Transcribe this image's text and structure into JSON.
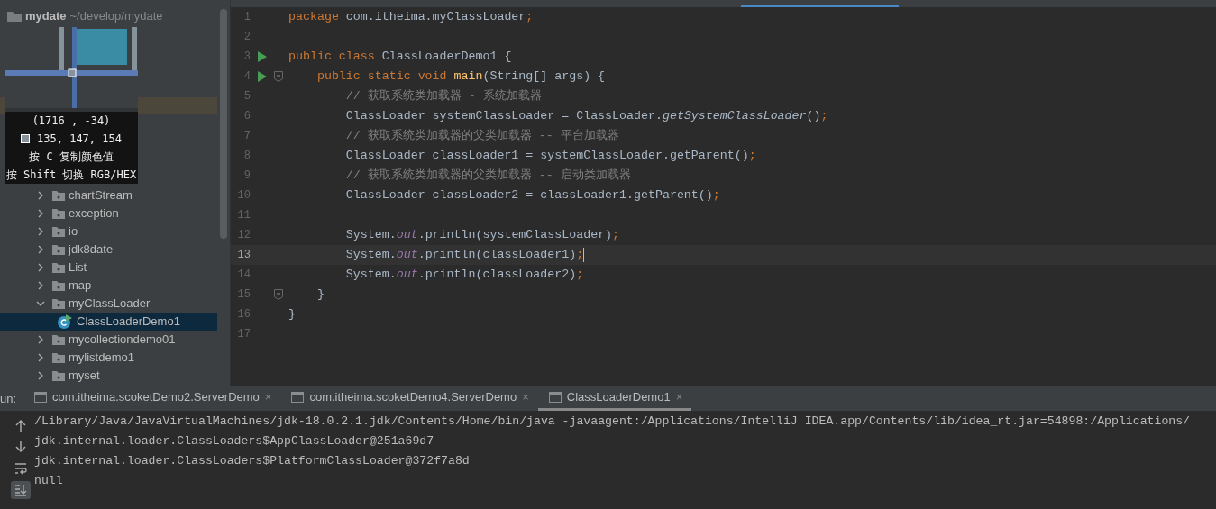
{
  "sidebar": {
    "root": {
      "name": "mydate",
      "path": "~/develop/mydate"
    },
    "items": [
      {
        "label": "chartStream",
        "kind": "folder",
        "expanded": false,
        "selected": false
      },
      {
        "label": "exception",
        "kind": "folder",
        "expanded": false,
        "selected": false
      },
      {
        "label": "io",
        "kind": "folder",
        "expanded": false,
        "selected": false
      },
      {
        "label": "jdk8date",
        "kind": "folder",
        "expanded": false,
        "selected": false
      },
      {
        "label": "List",
        "kind": "folder",
        "expanded": false,
        "selected": false
      },
      {
        "label": "map",
        "kind": "folder",
        "expanded": false,
        "selected": false
      },
      {
        "label": "myClassLoader",
        "kind": "folder",
        "expanded": true,
        "selected": false,
        "children": [
          {
            "label": "ClassLoaderDemo1",
            "kind": "class",
            "selected": true
          }
        ]
      },
      {
        "label": "mycollectiondemo01",
        "kind": "folder",
        "expanded": false,
        "selected": false
      },
      {
        "label": "mylistdemo1",
        "kind": "folder",
        "expanded": false,
        "selected": false
      },
      {
        "label": "myset",
        "kind": "folder",
        "expanded": false,
        "selected": false
      }
    ]
  },
  "color_picker": {
    "coordinates": "(1716 , -34)",
    "rgb": "135, 147, 154",
    "hints": [
      "按 C 复制颜色值",
      "按 Shift 切换 RGB/HEX"
    ]
  },
  "editor": {
    "lines": [
      {
        "number": "1",
        "runnable": false,
        "fold": false,
        "current": false,
        "segments": [
          {
            "kind": "keyword",
            "text": "package "
          },
          {
            "kind": "plain",
            "text": "com.itheima.myClassLoader"
          },
          {
            "kind": "keyword",
            "text": ";"
          }
        ]
      },
      {
        "number": "2",
        "runnable": false,
        "fold": false,
        "current": false
      },
      {
        "number": "3",
        "runnable": true,
        "fold": false,
        "current": false,
        "segments": [
          {
            "kind": "keyword",
            "text": "public class "
          },
          {
            "kind": "plain",
            "text": "ClassLoaderDemo1 {"
          }
        ]
      },
      {
        "number": "4",
        "runnable": true,
        "fold": true,
        "current": false,
        "segments": [
          {
            "kind": "keyword",
            "text": "    public static void "
          },
          {
            "kind": "method",
            "text": "main"
          },
          {
            "kind": "plain",
            "text": "(String[] args) {"
          }
        ]
      },
      {
        "number": "5",
        "runnable": false,
        "fold": false,
        "current": false,
        "segments": [
          {
            "kind": "comment",
            "text": "        // 获取系统类加载器 - 系统加载器"
          }
        ]
      },
      {
        "number": "6",
        "runnable": false,
        "fold": false,
        "current": false,
        "segments": [
          {
            "kind": "plain",
            "text": "        ClassLoader systemClassLoader = ClassLoader."
          },
          {
            "kind": "static",
            "text": "getSystemClassLoader"
          },
          {
            "kind": "plain",
            "text": "()"
          },
          {
            "kind": "keyword",
            "text": ";"
          }
        ]
      },
      {
        "number": "7",
        "runnable": false,
        "fold": false,
        "current": false,
        "segments": [
          {
            "kind": "comment",
            "text": "        // 获取系统类加载器的父类加载器 -- 平台加载器"
          }
        ]
      },
      {
        "number": "8",
        "runnable": false,
        "fold": false,
        "current": false,
        "segments": [
          {
            "kind": "plain",
            "text": "        ClassLoader classLoader1 = systemClassLoader.getParent()"
          },
          {
            "kind": "keyword",
            "text": ";"
          }
        ]
      },
      {
        "number": "9",
        "runnable": false,
        "fold": false,
        "current": false,
        "segments": [
          {
            "kind": "comment",
            "text": "        // 获取系统类加载器的父类加载器 -- 启动类加载器"
          }
        ]
      },
      {
        "number": "10",
        "runnable": false,
        "fold": false,
        "current": false,
        "segments": [
          {
            "kind": "plain",
            "text": "        ClassLoader classLoader2 = classLoader1.getParent()"
          },
          {
            "kind": "keyword",
            "text": ";"
          }
        ]
      },
      {
        "number": "11",
        "runnable": false,
        "fold": false,
        "current": false
      },
      {
        "number": "12",
        "runnable": false,
        "fold": false,
        "current": false,
        "segments": [
          {
            "kind": "plain",
            "text": "        System."
          },
          {
            "kind": "field",
            "text": "out"
          },
          {
            "kind": "plain",
            "text": ".println(systemClassLoader)"
          },
          {
            "kind": "keyword",
            "text": ";"
          }
        ]
      },
      {
        "number": "13",
        "runnable": false,
        "fold": false,
        "current": true,
        "segments": [
          {
            "kind": "plain",
            "text": "        System."
          },
          {
            "kind": "field",
            "text": "out"
          },
          {
            "kind": "plain",
            "text": ".println(classLoader1)"
          },
          {
            "kind": "keyword",
            "text": ";"
          }
        ]
      },
      {
        "number": "14",
        "runnable": false,
        "fold": false,
        "current": false,
        "segments": [
          {
            "kind": "plain",
            "text": "        System."
          },
          {
            "kind": "field",
            "text": "out"
          },
          {
            "kind": "plain",
            "text": ".println(classLoader2)"
          },
          {
            "kind": "keyword",
            "text": ";"
          }
        ]
      },
      {
        "number": "15",
        "runnable": false,
        "fold": true,
        "current": false,
        "segments": [
          {
            "kind": "plain",
            "text": "    }"
          }
        ]
      },
      {
        "number": "16",
        "runnable": false,
        "fold": false,
        "current": false,
        "segments": [
          {
            "kind": "plain",
            "text": "}"
          }
        ]
      },
      {
        "number": "17",
        "runnable": false,
        "fold": false,
        "current": false
      }
    ]
  },
  "run_panel": {
    "label": "un:",
    "tabs": [
      {
        "label": "com.itheima.scoketDemo2.ServerDemo",
        "close": "×",
        "selected": false
      },
      {
        "label": "com.itheima.scoketDemo4.ServerDemo",
        "close": "×",
        "selected": false
      },
      {
        "label": "ClassLoaderDemo1",
        "close": "×",
        "selected": true
      }
    ],
    "toolbar": [
      {
        "kind": "up",
        "active": false
      },
      {
        "kind": "down",
        "active": false
      },
      {
        "kind": "wrap",
        "active": false
      },
      {
        "kind": "scroll-end",
        "active": true
      }
    ],
    "output": [
      "/Library/Java/JavaVirtualMachines/jdk-18.0.2.1.jdk/Contents/Home/bin/java -javaagent:/Applications/IntelliJ IDEA.app/Contents/lib/idea_rt.jar=54898:/Applications/",
      "jdk.internal.loader.ClassLoaders$AppClassLoader@251a69d7",
      "jdk.internal.loader.ClassLoaders$PlatformClassLoader@372f7a8d",
      "null"
    ]
  }
}
